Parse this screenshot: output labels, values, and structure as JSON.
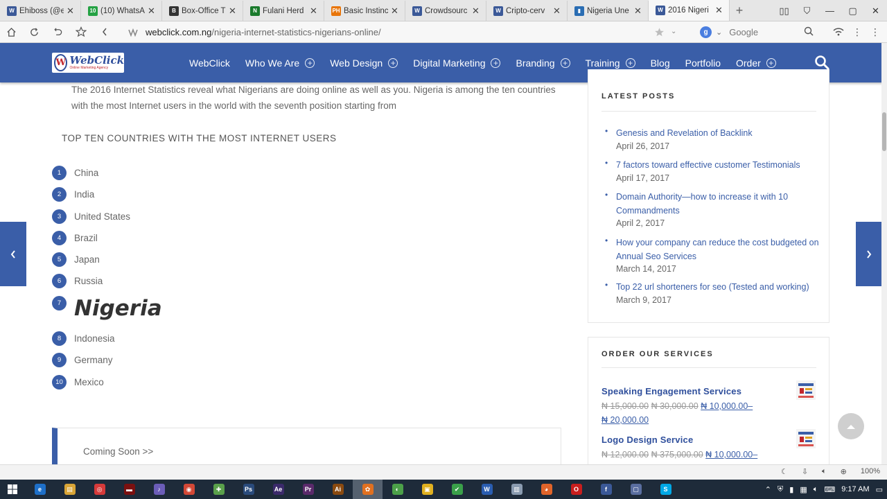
{
  "browser": {
    "tabs": [
      {
        "title": "Ehiboss (@e",
        "color": "#3b5998",
        "glyph": "W"
      },
      {
        "title": "(10) WhatsA",
        "color": "#25a244",
        "glyph": "10"
      },
      {
        "title": "Box-Office T",
        "color": "#333333",
        "glyph": "B"
      },
      {
        "title": "Fulani Herd",
        "color": "#1a7a2c",
        "glyph": "N"
      },
      {
        "title": "Basic Instinc",
        "color": "#e8750a",
        "glyph": "PH"
      },
      {
        "title": "Crowdsourc",
        "color": "#3b5998",
        "glyph": "W"
      },
      {
        "title": "Cripto-cerv",
        "color": "#3b5998",
        "glyph": "W"
      },
      {
        "title": "Nigeria Une",
        "color": "#2a6db3",
        "glyph": "▮"
      },
      {
        "title": "2016 Nigeri",
        "color": "#3b5998",
        "glyph": "W"
      }
    ],
    "url_domain": "webclick.com.ng",
    "url_path": "/nigeria-internet-statistics-nigerians-online/",
    "search_engine_label": "Google",
    "zoom": "100%"
  },
  "site": {
    "logo_text": "WebClick",
    "logo_sub": "Online Marketing Agency",
    "menu": [
      {
        "label": "WebClick",
        "has_sub": false
      },
      {
        "label": "Who We Are",
        "has_sub": true
      },
      {
        "label": "Web Design",
        "has_sub": true
      },
      {
        "label": "Digital Marketing",
        "has_sub": true
      },
      {
        "label": "Branding",
        "has_sub": true
      },
      {
        "label": "Training",
        "has_sub": true
      },
      {
        "label": "Blog",
        "has_sub": false
      },
      {
        "label": "Portfolio",
        "has_sub": false
      },
      {
        "label": "Order",
        "has_sub": true
      }
    ]
  },
  "article": {
    "intro": "The 2016 Internet Statistics reveal what Nigerians are doing online as well as you. Nigeria is among the ten countries with the most Internet users in the world with the seventh position starting from",
    "section_title": "TOP TEN COUNTRIES WITH THE MOST INTERNET USERS",
    "countries": [
      {
        "rank": "1",
        "name": "China"
      },
      {
        "rank": "2",
        "name": "India"
      },
      {
        "rank": "3",
        "name": "United States"
      },
      {
        "rank": "4",
        "name": "Brazil"
      },
      {
        "rank": "5",
        "name": "Japan"
      },
      {
        "rank": "6",
        "name": "Russia"
      },
      {
        "rank": "7",
        "name": "Nigeria"
      },
      {
        "rank": "8",
        "name": "Indonesia"
      },
      {
        "rank": "9",
        "name": "Germany"
      },
      {
        "rank": "10",
        "name": "Mexico"
      }
    ],
    "coming_soon": "Coming Soon >>"
  },
  "sidebar": {
    "latest_title": "LATEST POSTS",
    "posts": [
      {
        "title": "Genesis and Revelation of Backlink",
        "date": "April 26, 2017"
      },
      {
        "title": "7 factors toward effective customer Testimonials",
        "date": "April 17, 2017"
      },
      {
        "title": "Domain Authority—how to increase it with 10 Commandments",
        "date": "April 2, 2017"
      },
      {
        "title": "How your company can reduce the cost budgeted on Annual Seo Services",
        "date": "March 14, 2017"
      },
      {
        "title": "Top 22 url shorteners for seo (Tested and working)",
        "date": "March 9, 2017"
      }
    ],
    "order_title": "ORDER OUR SERVICES",
    "services": [
      {
        "name": "Speaking Engagement Services",
        "old1": "₦ 15,000.00",
        "old2": "₦ 30,000.00",
        "new": "₦ 10,000.00–",
        "new2": "₦ 20,000.00"
      },
      {
        "name": "Logo Design Service",
        "old1": "₦ 12,000.00",
        "old2": "₦ 375,000.00",
        "new": "₦ 10,000.00–",
        "new2": ""
      }
    ]
  },
  "taskbar": {
    "time": "9:17 AM",
    "apps": [
      {
        "glyph": "e",
        "color": "#1e6fc8"
      },
      {
        "glyph": "▤",
        "color": "#d9a537"
      },
      {
        "glyph": "◎",
        "color": "#d63a3a"
      },
      {
        "glyph": "▬",
        "color": "#7a1010"
      },
      {
        "glyph": "♪",
        "color": "#6b5db8"
      },
      {
        "glyph": "◉",
        "color": "#d34836"
      },
      {
        "glyph": "✚",
        "color": "#5aa04b"
      },
      {
        "glyph": "Ps",
        "color": "#2a4b7c"
      },
      {
        "glyph": "Ae",
        "color": "#3b2a6b"
      },
      {
        "glyph": "Pr",
        "color": "#5b2a6b"
      },
      {
        "glyph": "Ai",
        "color": "#8a4a10"
      },
      {
        "glyph": "✿",
        "color": "#e07020"
      },
      {
        "glyph": "◐",
        "color": "#4ca049"
      },
      {
        "glyph": "▣",
        "color": "#e0b020"
      },
      {
        "glyph": "✔",
        "color": "#3aa04a"
      },
      {
        "glyph": "W",
        "color": "#2a5db0"
      },
      {
        "glyph": "▥",
        "color": "#8a9bb0"
      },
      {
        "glyph": "◕",
        "color": "#e0642a"
      },
      {
        "glyph": "O",
        "color": "#c81e1e"
      },
      {
        "glyph": "f",
        "color": "#3b5998"
      },
      {
        "glyph": "▢",
        "color": "#5a6ea0"
      },
      {
        "glyph": "S",
        "color": "#00a8e6"
      }
    ]
  }
}
